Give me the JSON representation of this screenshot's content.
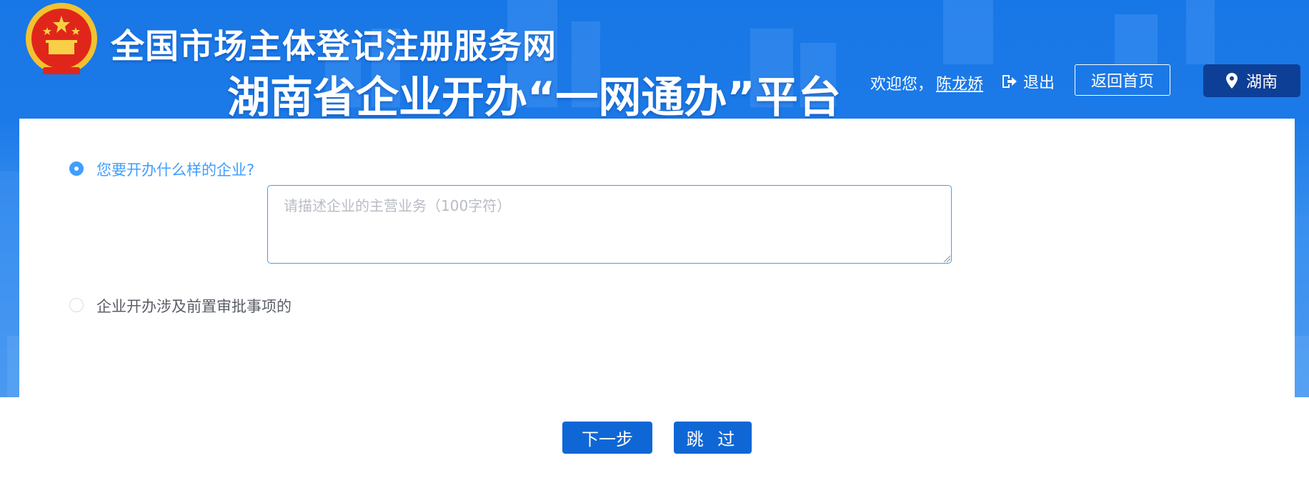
{
  "header": {
    "site_title": "全国市场主体登记注册服务网",
    "platform_title": "湖南省企业开办“一网通办”平台",
    "welcome_text": "欢迎您，",
    "username": "陈龙娇",
    "logout_label": "退出",
    "home_button": "返回首页",
    "region_button": "湖南"
  },
  "form": {
    "option1_label": "您要开办什么样的企业?",
    "option1_selected": true,
    "business_placeholder": "请描述企业的主营业务（100字符）",
    "option2_label": "企业开办涉及前置审批事项的",
    "option2_selected": false
  },
  "actions": {
    "next_label": "下一步",
    "skip_label": "跳 过"
  },
  "colors": {
    "banner_blue": "#1877e6",
    "accent": "#409eff",
    "button_blue": "#0f67d6",
    "region_button_bg": "#0e3f96"
  }
}
